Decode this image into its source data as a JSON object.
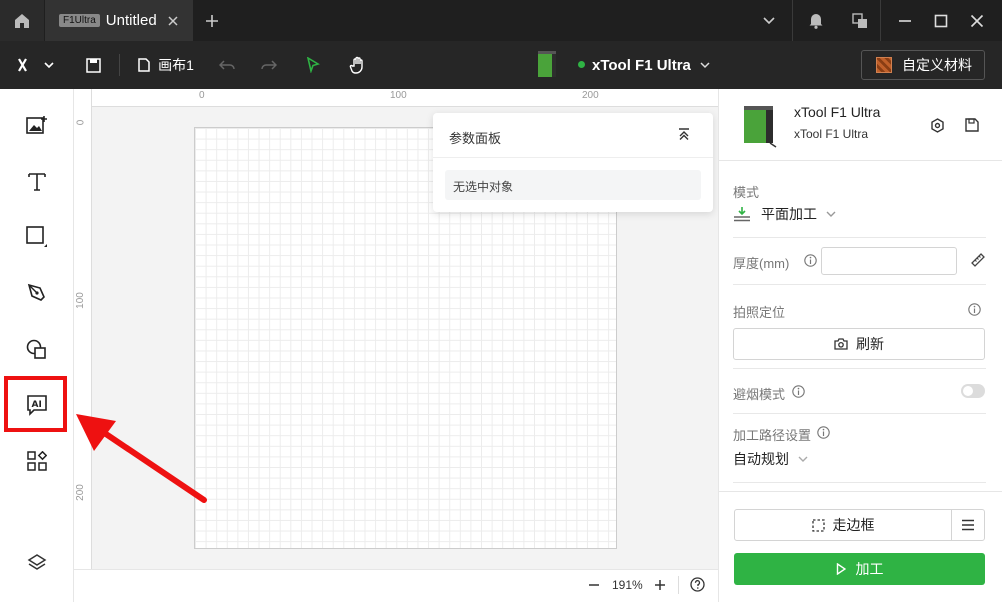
{
  "titlebar": {
    "tab_badge": "F1Ultra",
    "tab_title": "Untitled"
  },
  "toolbar": {
    "canvas_label": "画布1",
    "device_name": "xTool F1 Ultra",
    "device_status_color": "#2fb344",
    "custom_material_label": "自定义材料"
  },
  "rulers": {
    "top": [
      "0",
      "100",
      "200"
    ],
    "left": [
      "0",
      "100",
      "200"
    ]
  },
  "param_panel": {
    "title": "参数面板",
    "empty_text": "无选中对象"
  },
  "bottom_bar": {
    "zoom": "191%"
  },
  "right_panel": {
    "device_name": "xTool F1 Ultra",
    "device_model": "xTool F1 Ultra",
    "mode_label": "模式",
    "mode_value": "平面加工",
    "thickness_label": "厚度(mm)",
    "thickness_value": "",
    "photo_position_label": "拍照定位",
    "refresh_label": "刷新",
    "smoke_mode_label": "避烟模式",
    "path_settings_label": "加工路径设置",
    "path_value": "自动规划",
    "frame_label": "走边框",
    "process_label": "加工"
  },
  "colors": {
    "accent_green": "#2fb344",
    "annotation_red": "#ee1111"
  }
}
